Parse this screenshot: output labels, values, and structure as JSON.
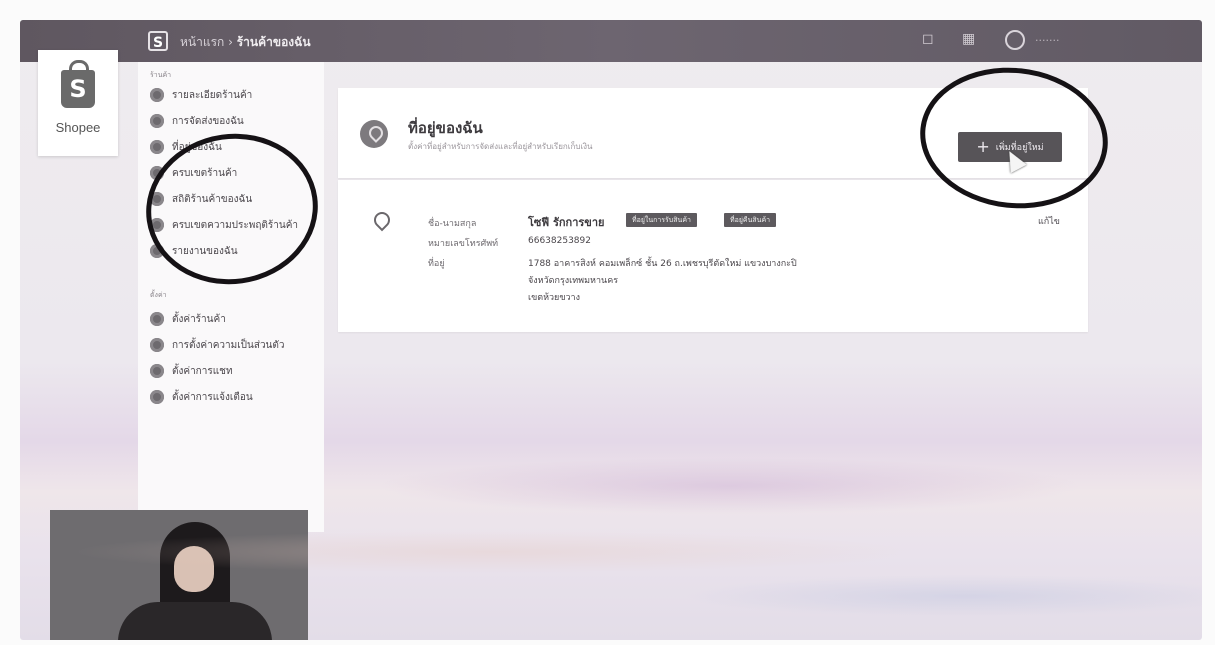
{
  "topbar": {
    "logo_glyph": "S",
    "breadcrumb_root": "หน้าแรก",
    "breadcrumb_sep": " › ",
    "breadcrumb_current": "ร้านค้าของฉัน",
    "user_name": "·······"
  },
  "logo": {
    "glyph": "S",
    "wordmark": "Shopee"
  },
  "sidebar": {
    "section1_heading": "ร้านค้า",
    "section1_items": [
      "รายละเอียดร้านค้า",
      "การจัดส่งของฉัน",
      "ที่อยู่ของฉัน",
      "ครบเขตร้านค้า",
      "สถิติร้านค้าของฉัน",
      "ครบเขตความประพฤติร้านค้า",
      "รายงานของฉัน"
    ],
    "section2_heading": "ตั้งค่า",
    "section2_items": [
      "ตั้งค่าร้านค้า",
      "การตั้งค่าความเป็นส่วนตัว",
      "ตั้งค่าการแชท",
      "ตั้งค่าการแจ้งเตือน"
    ]
  },
  "header": {
    "title": "ที่อยู่ของฉัน",
    "subtitle": "ตั้งค่าที่อยู่สำหรับการจัดส่งและที่อยู่สำหรับเรียกเก็บเงิน",
    "add_button_label": "เพิ่มที่อยู่ใหม่",
    "add_button_plus": "+"
  },
  "address": {
    "name_label": "ชื่อ-นามสกุล",
    "name_value": "โซฟี รักการขาย",
    "tag_default_pickup": "ที่อยู่ในการรับสินค้า",
    "tag_default_return": "ที่อยู่คืนสินค้า",
    "phone_label": "หมายเลขโทรศัพท์",
    "phone_value": "66638253892",
    "address_label": "ที่อยู่",
    "address_line1": "1788 อาคารสิงห์ คอมเพล็กซ์ ชั้น 26 ถ.เพชรบุรีตัดใหม่ แขวงบางกะปิ",
    "address_line2": "จังหวัดกรุงเทพมหานคร",
    "address_line3": "เขตห้วยขวาง",
    "edit_label": "แก้ไข"
  }
}
